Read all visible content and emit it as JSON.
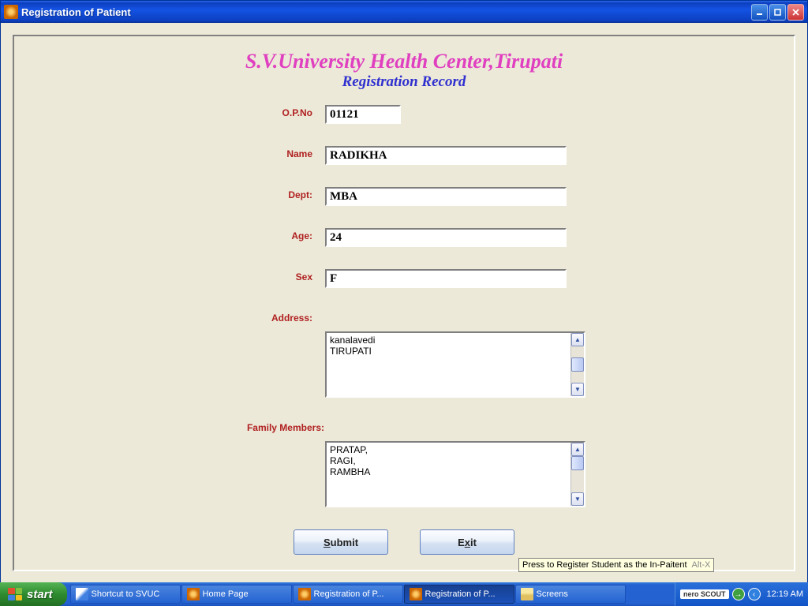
{
  "window": {
    "title": "Registration of Patient"
  },
  "headings": {
    "main": "S.V.University Health Center,Tirupati",
    "sub": "Registration Record"
  },
  "form": {
    "labels": {
      "opno": "O.P.No",
      "name": "Name",
      "dept": "Dept:",
      "age": "Age:",
      "sex": "Sex",
      "address": "Address:",
      "family": "Family Members:"
    },
    "values": {
      "opno": "01121",
      "name": "RADIKHA",
      "dept": "MBA",
      "age": "24",
      "sex": "F",
      "address": "kanalavedi\nTIRUPATI",
      "family": "PRATAP,\nRAGI,\nRAMBHA"
    }
  },
  "buttons": {
    "submit": "Submit",
    "exit": "Exit"
  },
  "tooltip": {
    "text": "Press to Register Student as the In-Paitent",
    "hotkey": "Alt-X"
  },
  "taskbar": {
    "start": "start",
    "items": [
      {
        "label": "Shortcut to SVUC",
        "icon": "shortcut",
        "active": false
      },
      {
        "label": "Home Page",
        "icon": "java",
        "active": false
      },
      {
        "label": "Registration of P...",
        "icon": "java",
        "active": false
      },
      {
        "label": "Registration of P...",
        "icon": "java",
        "active": true
      },
      {
        "label": "Screens",
        "icon": "folder",
        "active": false
      }
    ],
    "tray_badge": "nero SCOUT",
    "clock": "12:19 AM"
  }
}
